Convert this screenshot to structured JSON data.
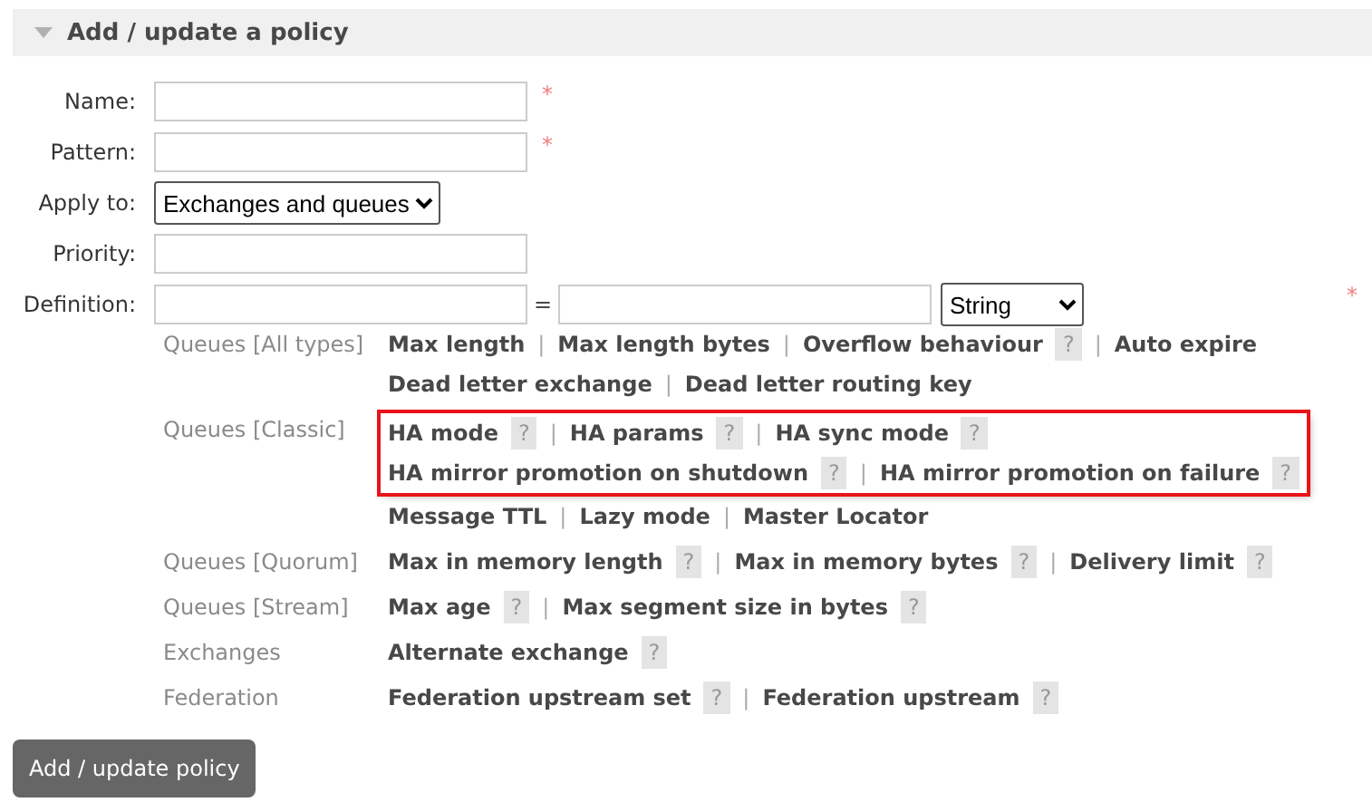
{
  "section": {
    "title": "Add / update a policy",
    "expanded": true
  },
  "fields": [
    {
      "kind": "text",
      "label": "Name:",
      "required_mark": "*"
    },
    {
      "kind": "text",
      "label": "Pattern:",
      "required_mark": "*"
    },
    {
      "kind": "select",
      "label": "Apply to:",
      "value": "Exchanges and queues"
    },
    {
      "kind": "text",
      "label": "Priority:"
    },
    {
      "kind": "definition",
      "label": "Definition:",
      "equals": "=",
      "type_value": "String",
      "required_mark": "*"
    }
  ],
  "separator": "|",
  "groups": [
    {
      "label": "Queues [All types]",
      "blocks": [
        {
          "highlighted": false,
          "lines": [
            {
              "links": [
                {
                  "label": "Max length"
                },
                {
                  "label": "Max length bytes"
                },
                {
                  "label": "Overflow behaviour",
                  "help": "?"
                },
                {
                  "label": "Auto expire"
                }
              ]
            },
            {
              "links": [
                {
                  "label": "Dead letter exchange"
                },
                {
                  "label": "Dead letter routing key"
                }
              ]
            }
          ]
        }
      ]
    },
    {
      "label": "Queues [Classic]",
      "blocks": [
        {
          "highlighted": true,
          "lines": [
            {
              "links": [
                {
                  "label": "HA mode",
                  "help": "?"
                },
                {
                  "label": "HA params",
                  "help": "?"
                },
                {
                  "label": "HA sync mode",
                  "help": "?"
                }
              ]
            },
            {
              "links": [
                {
                  "label": "HA mirror promotion on shutdown",
                  "help": "?"
                },
                {
                  "label": "HA mirror promotion on failure",
                  "help": "?"
                }
              ]
            }
          ]
        },
        {
          "highlighted": false,
          "lines": [
            {
              "links": [
                {
                  "label": "Message TTL"
                },
                {
                  "label": "Lazy mode"
                },
                {
                  "label": "Master Locator"
                }
              ]
            }
          ]
        }
      ]
    },
    {
      "label": "Queues [Quorum]",
      "blocks": [
        {
          "highlighted": false,
          "lines": [
            {
              "links": [
                {
                  "label": "Max in memory length",
                  "help": "?"
                },
                {
                  "label": "Max in memory bytes",
                  "help": "?"
                },
                {
                  "label": "Delivery limit",
                  "help": "?"
                }
              ]
            }
          ]
        }
      ]
    },
    {
      "label": "Queues [Stream]",
      "blocks": [
        {
          "highlighted": false,
          "lines": [
            {
              "links": [
                {
                  "label": "Max age",
                  "help": "?"
                },
                {
                  "label": "Max segment size in bytes",
                  "help": "?"
                }
              ]
            }
          ]
        }
      ]
    },
    {
      "label": "Exchanges",
      "blocks": [
        {
          "highlighted": false,
          "lines": [
            {
              "links": [
                {
                  "label": "Alternate exchange",
                  "help": "?"
                }
              ]
            }
          ]
        }
      ]
    },
    {
      "label": "Federation",
      "blocks": [
        {
          "highlighted": false,
          "lines": [
            {
              "links": [
                {
                  "label": "Federation upstream set",
                  "help": "?"
                },
                {
                  "label": "Federation upstream",
                  "help": "?"
                }
              ]
            }
          ]
        }
      ]
    }
  ],
  "submit": "Add / update policy"
}
